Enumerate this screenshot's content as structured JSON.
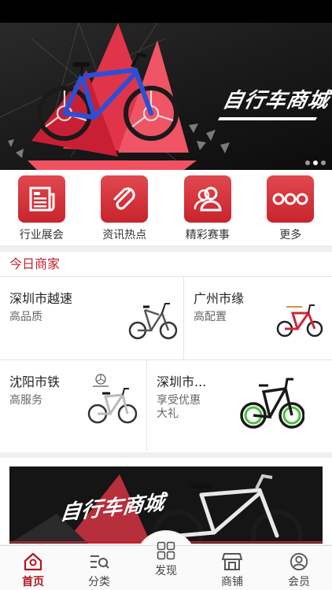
{
  "banner": {
    "title": "自行车商城",
    "dots": [
      false,
      true,
      false
    ]
  },
  "quick_menu": [
    {
      "label": "行业展会",
      "icon": "newspaper-icon"
    },
    {
      "label": "资讯热点",
      "icon": "paperclip-icon"
    },
    {
      "label": "精彩赛事",
      "icon": "users-icon"
    },
    {
      "label": "更多",
      "icon": "more-dots-icon"
    }
  ],
  "merchants": {
    "title": "今日商家",
    "items": [
      {
        "name": "深圳市越速",
        "desc": "高品质"
      },
      {
        "name": "广州市缘",
        "desc": "高配置"
      },
      {
        "name": "沈阳市铁",
        "desc": "高服务"
      },
      {
        "name": "深圳市...",
        "desc": "享受优惠大礼"
      }
    ]
  },
  "promo": {
    "title": "自行车商城"
  },
  "tabs": [
    {
      "label": "首页",
      "icon": "home-icon",
      "active": true
    },
    {
      "label": "分类",
      "icon": "category-search-icon",
      "active": false
    },
    {
      "label": "发现",
      "icon": "grid-icon",
      "active": false
    },
    {
      "label": "商铺",
      "icon": "store-icon",
      "active": false
    },
    {
      "label": "会员",
      "icon": "user-icon",
      "active": false
    }
  ],
  "colors": {
    "accent": "#c0202d",
    "icon_red": "#d6343c"
  }
}
